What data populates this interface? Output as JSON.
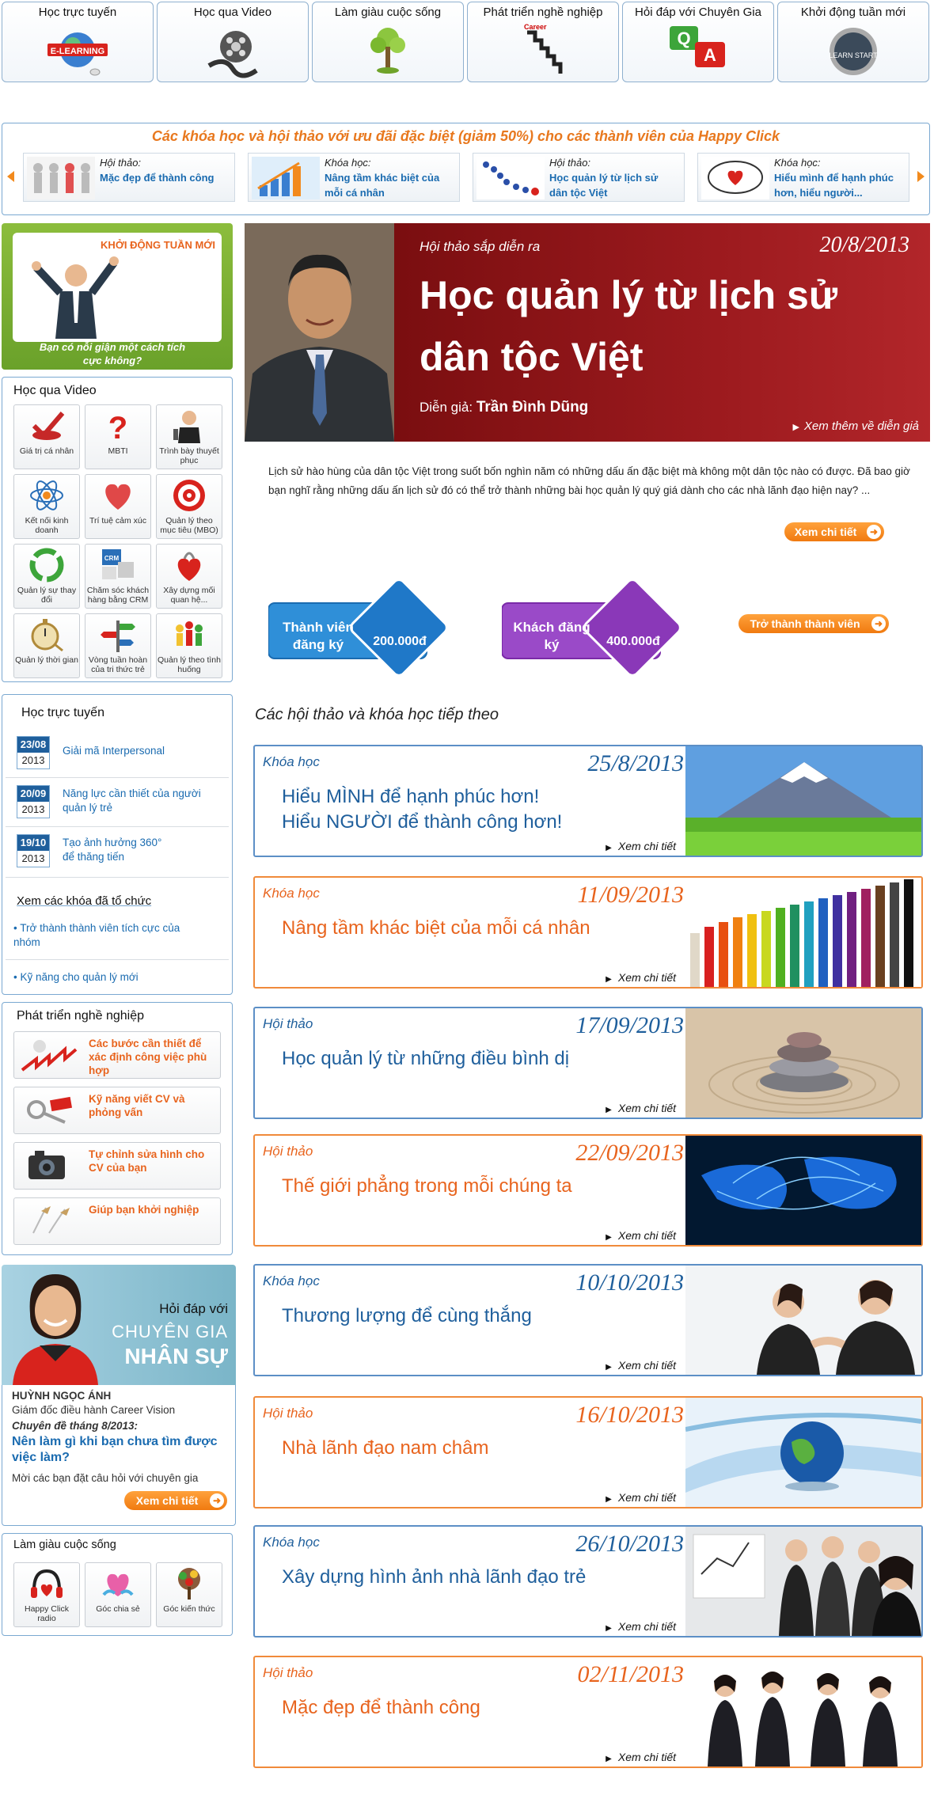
{
  "top_nav": [
    {
      "label": "Học trực tuyến",
      "icon": "elearning-icon",
      "icon_text": "E-LEARNING"
    },
    {
      "label": "Học qua Video",
      "icon": "film-reel-icon"
    },
    {
      "label": "Làm giàu cuộc sống",
      "icon": "tree-icon"
    },
    {
      "label": "Phát triển nghề nghiệp",
      "icon": "career-stairs-icon",
      "icon_text": "Career"
    },
    {
      "label": "Hỏi đáp với Chuyên Gia",
      "icon": "qa-icon",
      "icon_text_q": "Q",
      "icon_text_a": "A"
    },
    {
      "label": "Khởi động tuần mới",
      "icon": "learn-start-icon",
      "icon_text": "LEARN START"
    }
  ],
  "promo": {
    "title": "Các khóa học và hội thảo với ưu đãi đặc biệt (giảm 50%) cho các thành viên của Happy Click",
    "cards": [
      {
        "type": "Hội thảo:",
        "title": "Mặc đẹp để thành công"
      },
      {
        "type": "Khóa học:",
        "title": "Nâng tầm khác biệt của mỗi cá nhân"
      },
      {
        "type": "Hội thảo:",
        "title": "Học quản lý từ lịch sử dân tộc Việt"
      },
      {
        "type": "Khóa học:",
        "title": "Hiểu mình để hạnh phúc hơn, hiểu người..."
      }
    ]
  },
  "week_box": {
    "title": "KHỞI ĐỘNG TUẦN MỚI",
    "caption": "Bạn có nỗi giận một cách tích cực không?"
  },
  "video_box": {
    "title": "Học qua Video",
    "items": [
      {
        "label": "Giá trị cá nhân",
        "icon": "checkmark-icon"
      },
      {
        "label": "MBTI",
        "icon": "question-mark-icon"
      },
      {
        "label": "Trình bày thuyết phục",
        "icon": "presenter-icon"
      },
      {
        "label": "Kết nối kinh doanh",
        "icon": "atom-icon"
      },
      {
        "label": "Trí tuệ cảm xúc",
        "icon": "heart-icon"
      },
      {
        "label": "Quản lý theo mục tiêu (MBO)",
        "icon": "target-icon"
      },
      {
        "label": "Quản lý sự thay đổi",
        "icon": "recycle-icon"
      },
      {
        "label": "Chăm sóc khách hàng bằng CRM",
        "icon": "crm-icon",
        "icon_text": "CRM"
      },
      {
        "label": "Xây dựng mối quan hệ...",
        "icon": "heart-lock-icon"
      },
      {
        "label": "Quản lý thời gian",
        "icon": "stopwatch-icon"
      },
      {
        "label": "Vòng tuần hoàn của tri thức trẻ",
        "icon": "signpost-icon"
      },
      {
        "label": "Quản lý theo tình huống",
        "icon": "people-icon"
      }
    ]
  },
  "online_box": {
    "title": "Học trực tuyến",
    "courses": [
      {
        "day": "23/08",
        "year": "2013",
        "title": "Giải mã Interpersonal"
      },
      {
        "day": "20/09",
        "year": "2013",
        "title": "Năng lực cần thiết của người quản lý trẻ"
      },
      {
        "day": "19/10",
        "year": "2013",
        "title": "Tạo ảnh hưởng 360°",
        "title2": "để thăng tiến"
      }
    ],
    "past_title": "Xem các khóa đã tổ chức",
    "past": [
      "Trở thành thành viên tích cực của nhóm",
      "Kỹ năng cho quản lý mới"
    ]
  },
  "career_box": {
    "title": "Phát triển nghề nghiệp",
    "items": [
      {
        "label": "Các bước cần thiết để xác định công việc phù hợp",
        "icon": "jobs-icon"
      },
      {
        "label": "Kỹ năng viết CV và phỏng vấn",
        "icon": "keys-icon"
      },
      {
        "label": "Tự chỉnh sửa hình cho CV của bạn",
        "icon": "camera-icon"
      },
      {
        "label": "Giúp bạn khởi nghiệp",
        "icon": "planes-icon"
      }
    ]
  },
  "expert": {
    "heading1": "Hỏi đáp với",
    "heading2": "CHUYÊN GIA",
    "heading3": "NHÂN SỰ",
    "name": "HUỲNH NGỌC ÁNH",
    "role": "Giám đốc điều hành Career Vision",
    "topic_label": "Chuyên đề tháng 8/2013:",
    "topic": "Nên làm gì khi bạn chưa tìm được việc làm?",
    "invite": "Mời các bạn đặt câu hỏi với chuyên gia",
    "button": "Xem chi tiết"
  },
  "life_box": {
    "title": "Làm giàu cuộc sống",
    "items": [
      {
        "label": "Happy Click radio",
        "icon": "headphones-heart-icon"
      },
      {
        "label": "Góc chia sẻ",
        "icon": "hands-heart-icon"
      },
      {
        "label": "Góc kiến thức",
        "icon": "tree-books-icon"
      }
    ]
  },
  "featured": {
    "upcoming": "Hội thảo sắp diễn ra",
    "date": "20/8/2013",
    "title": "Học quản lý từ lịch sử dân tộc Việt",
    "speaker_label": "Diễn giả:",
    "speaker": "Trần Đình Dũng",
    "speaker_more": "Xem thêm về diễn giả",
    "description": "Lịch sử hào hùng của dân tộc Việt trong suốt bốn nghìn năm có những dấu ấn đặc biệt mà không một dân tộc nào có được. Đã bao giờ bạn nghĩ rằng những dấu ấn lịch sử đó có thể trở thành những bài học quản lý quý giá dành cho các nhà lãnh đạo hiện nay? ...",
    "detail_button": "Xem chi tiết",
    "member_label": "Thành viên đăng ký",
    "member_price": "200.000đ",
    "guest_label": "Khách đăng ký",
    "guest_price": "400.000đ",
    "join_button": "Trở thành thành viên"
  },
  "next_events": {
    "title": "Các hội thảo và khóa học tiếp theo",
    "detail_label": "Xem chi tiết",
    "items": [
      {
        "type": "Khóa học",
        "date": "25/8/2013",
        "title": "Hiểu MÌNH để hạnh phúc hơn!",
        "title2": "Hiểu NGƯỜI để thành công hơn!",
        "style": "blue",
        "image": "mountain-image"
      },
      {
        "type": "Khóa học",
        "date": "11/09/2013",
        "title": "Nâng tầm khác biệt của mỗi cá nhân",
        "style": "orange",
        "image": "pencils-image"
      },
      {
        "type": "Hội thảo",
        "date": "17/09/2013",
        "title": "Học quản lý từ những điều bình dị",
        "style": "blue",
        "image": "stones-image"
      },
      {
        "type": "Hội thảo",
        "date": "22/09/2013",
        "title": "Thế giới phẳng trong mỗi chúng ta",
        "style": "orange",
        "image": "world-map-image"
      },
      {
        "type": "Khóa học",
        "date": "10/10/2013",
        "title": "Thương lượng để cùng thắng",
        "style": "blue",
        "image": "handshake-image"
      },
      {
        "type": "Hội thảo",
        "date": "16/10/2013",
        "title": "Nhà lãnh đạo nam châm",
        "style": "orange",
        "image": "globe-image"
      },
      {
        "type": "Khóa học",
        "date": "26/10/2013",
        "title": "Xây dựng hình ảnh nhà lãnh đạo trẻ",
        "style": "blue",
        "image": "team-image"
      },
      {
        "type": "Hội thảo",
        "date": "02/11/2013",
        "title": "Mặc đẹp để thành công",
        "style": "orange",
        "image": "businesswomen-image"
      }
    ]
  }
}
